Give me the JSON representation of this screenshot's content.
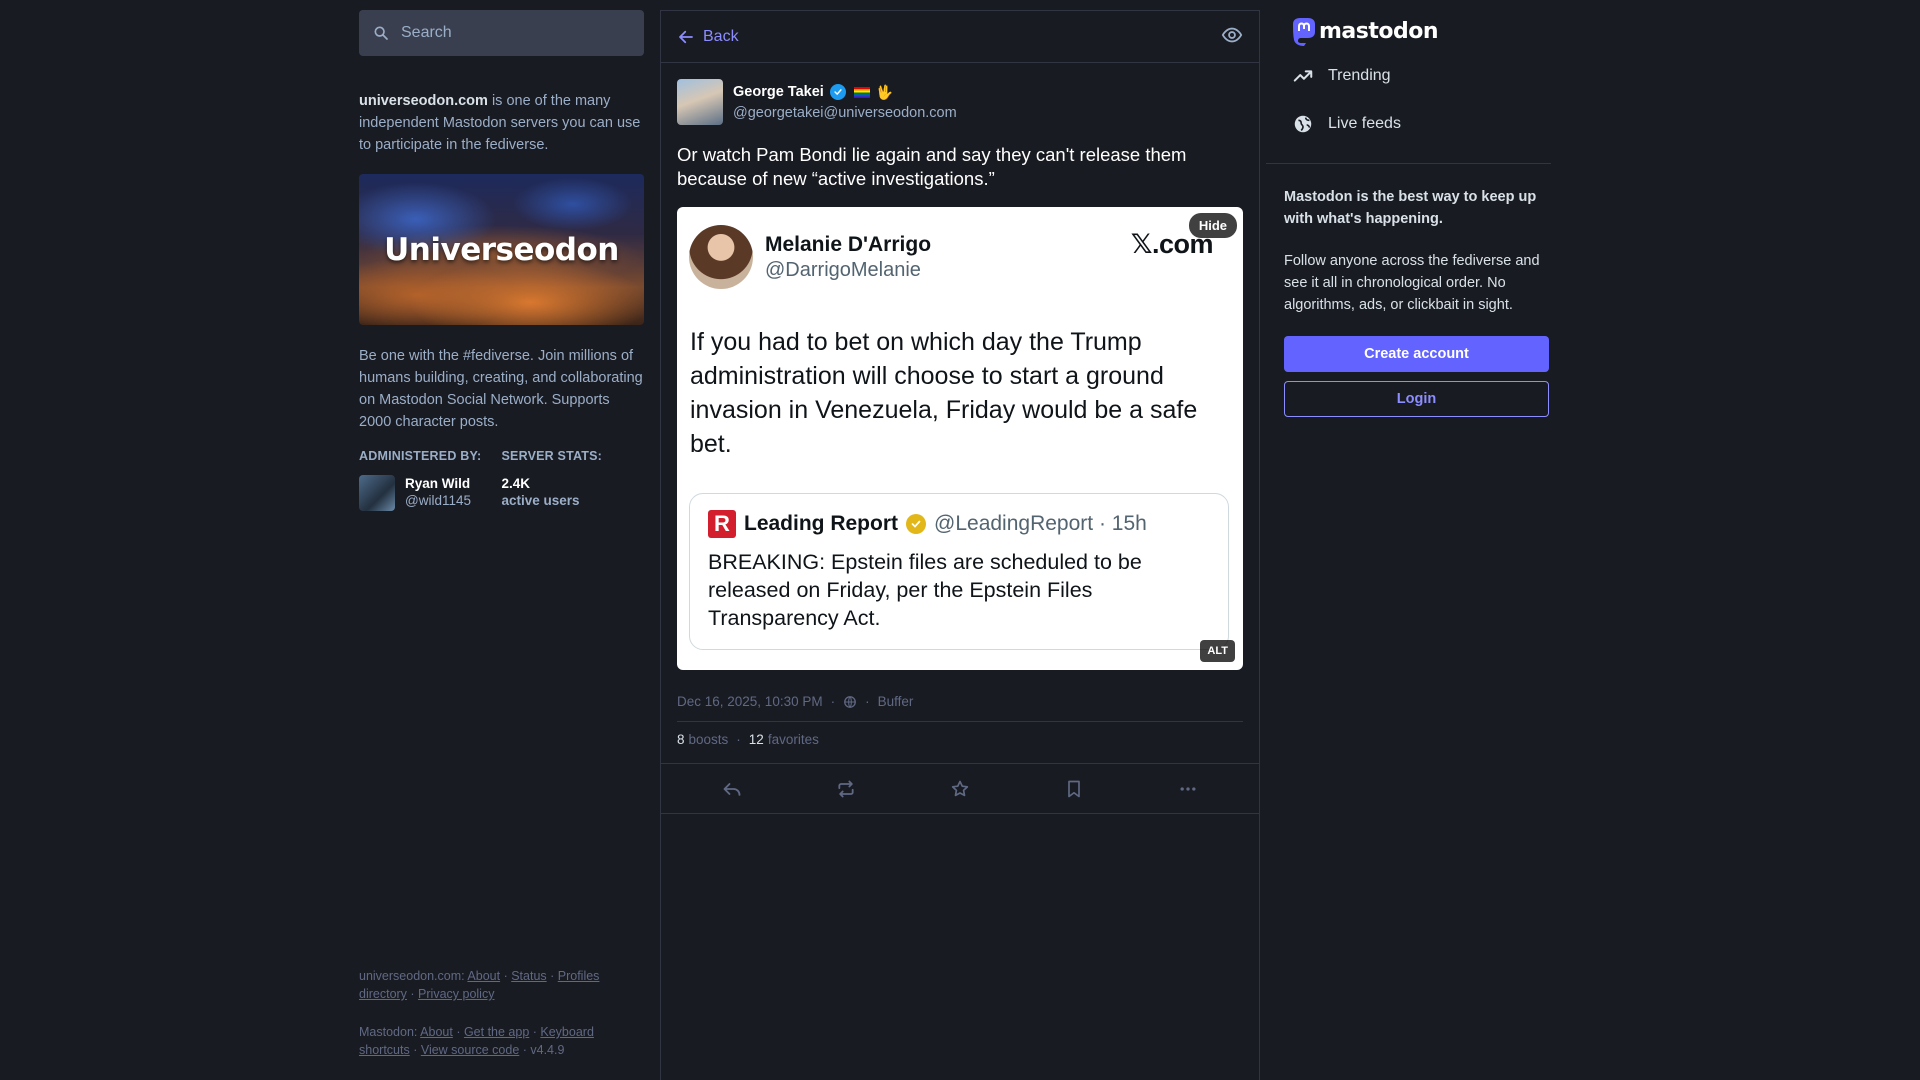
{
  "search": {
    "placeholder": "Search"
  },
  "server": {
    "domain": "universeodon.com",
    "intro": " is one of the many independent Mastodon servers you can use to participate in the fediverse.",
    "hero_text": "Universeodon",
    "description": "Be one with the #fediverse. Join millions of humans building, creating, and collaborating on Mastodon Social Network. Supports 2000 character posts.",
    "admin_label": "ADMINISTERED BY:",
    "stats_label": "SERVER STATS:",
    "admin_name": "Ryan Wild",
    "admin_handle": "@wild1145",
    "active_users_count": "2.4K",
    "active_users_label": "active users"
  },
  "footer": {
    "server_prefix": "universeodon.com",
    "about": "About",
    "status": "Status",
    "profiles_directory": "Profiles directory",
    "privacy_policy": "Privacy policy",
    "mastodon_prefix": "Mastodon",
    "mastodon_about": "About",
    "get_app": "Get the app",
    "keyboard_shortcuts": "Keyboard shortcuts",
    "view_source": "View source code",
    "version": "v4.4.9"
  },
  "header": {
    "back_label": "Back"
  },
  "post": {
    "author_name": "George Takei",
    "author_hand_emoji": "🖖",
    "author_handle": "@georgetakei@universeodon.com",
    "text": "Or watch Pam Bondi lie again and say they can't release them because of new “active investigations.”",
    "media": {
      "hide_label": "Hide",
      "alt_label": "ALT",
      "tweet_name": "Melanie D'Arrigo",
      "tweet_handle": "@DarrigoMelanie",
      "tweet_brand": "𝕏.com",
      "tweet_text": "If you had to bet on which day the Trump administration will choose to start a ground invasion in Venezuela, Friday would be a safe bet.",
      "quote_logo": "R",
      "quote_name": "Leading Report",
      "quote_handle": "@LeadingReport · 15h",
      "quote_text": "BREAKING: Epstein files are scheduled to be released on Friday, per the Epstein Files Transparency Act."
    },
    "timestamp": "Dec 16, 2025, 10:30 PM",
    "app": "Buffer",
    "boosts_count": "8",
    "boosts_label": "boosts",
    "favorites_count": "12",
    "favorites_label": "favorites"
  },
  "nav": {
    "logo_word": "mastodon",
    "trending": "Trending",
    "live_feeds": "Live feeds"
  },
  "cta": {
    "title": "Mastodon is the best way to keep up with what's happening.",
    "description": "Follow anyone across the fediverse and see it all in chronological order. No algorithms, ads, or clickbait in sight.",
    "create_account": "Create account",
    "login": "Login"
  },
  "colors": {
    "background": "#191b22",
    "accent": "#6364ff",
    "link": "#8c8dff",
    "muted": "#9baec8"
  }
}
